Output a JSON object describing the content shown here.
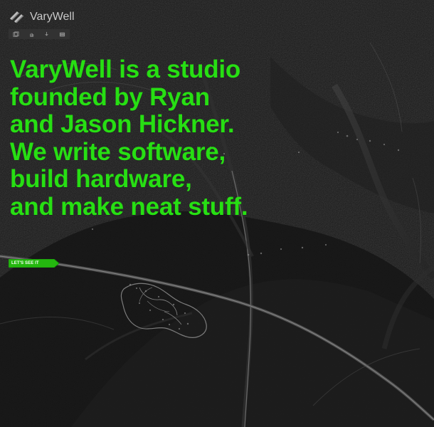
{
  "brand": {
    "name": "VaryWell",
    "logo_icon": "varywell-logo-icon"
  },
  "toolbar": {
    "items": [
      {
        "icon": "window-icon"
      },
      {
        "icon": "hand-icon"
      },
      {
        "icon": "download-icon"
      },
      {
        "icon": "menu-icon"
      }
    ]
  },
  "hero": {
    "lines": [
      "VaryWell is a studio",
      "founded by Ryan",
      "and Jason Hickner.",
      "We write software,",
      "build hardware,",
      "and make neat stuff."
    ],
    "cta_label": "LET'S SEE IT"
  },
  "colors": {
    "accent": "#27df13",
    "background": "#171717",
    "brand_text": "#c9c9c9",
    "cta": "#24b70f"
  }
}
